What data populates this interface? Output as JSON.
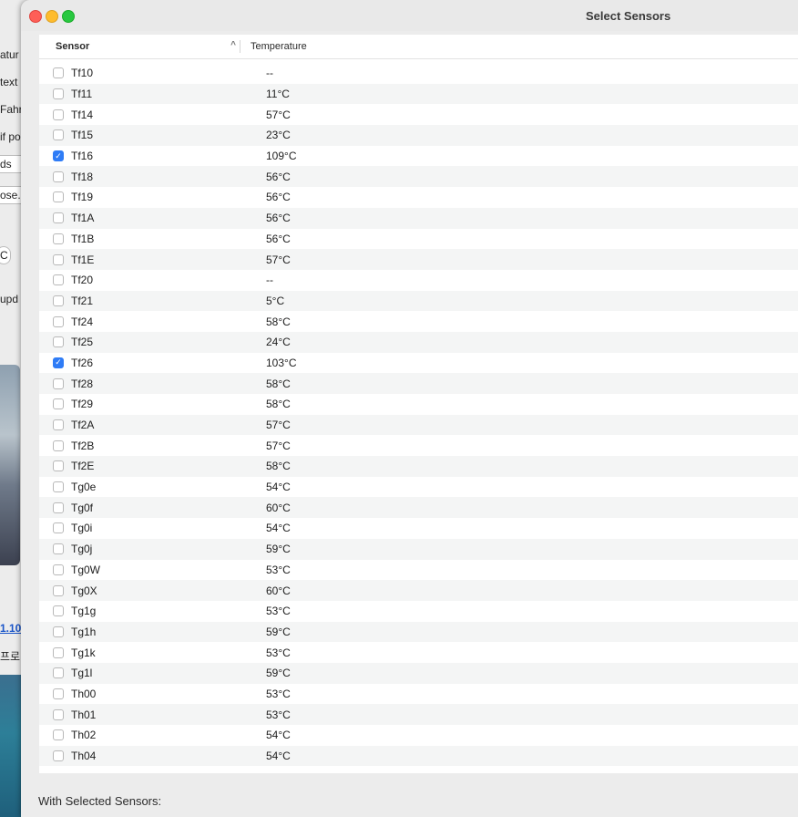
{
  "background_app": {
    "fragments": [
      "atur",
      "text",
      "Fahre",
      "if po",
      "ds",
      "ose.",
      "C",
      "upd",
      "1.10",
      "프로"
    ]
  },
  "window": {
    "title": "Select Sensors",
    "columns": {
      "sensor": "Sensor",
      "temperature": "Temperature"
    },
    "sort_indicator": "^",
    "rows": [
      {
        "sensor": "Tf10",
        "temp": "--",
        "checked": false
      },
      {
        "sensor": "Tf11",
        "temp": "11°C",
        "checked": false
      },
      {
        "sensor": "Tf14",
        "temp": "57°C",
        "checked": false
      },
      {
        "sensor": "Tf15",
        "temp": "23°C",
        "checked": false
      },
      {
        "sensor": "Tf16",
        "temp": "109°C",
        "checked": true
      },
      {
        "sensor": "Tf18",
        "temp": "56°C",
        "checked": false
      },
      {
        "sensor": "Tf19",
        "temp": "56°C",
        "checked": false
      },
      {
        "sensor": "Tf1A",
        "temp": "56°C",
        "checked": false
      },
      {
        "sensor": "Tf1B",
        "temp": "56°C",
        "checked": false
      },
      {
        "sensor": "Tf1E",
        "temp": "57°C",
        "checked": false
      },
      {
        "sensor": "Tf20",
        "temp": "--",
        "checked": false
      },
      {
        "sensor": "Tf21",
        "temp": "5°C",
        "checked": false
      },
      {
        "sensor": "Tf24",
        "temp": "58°C",
        "checked": false
      },
      {
        "sensor": "Tf25",
        "temp": "24°C",
        "checked": false
      },
      {
        "sensor": "Tf26",
        "temp": "103°C",
        "checked": true
      },
      {
        "sensor": "Tf28",
        "temp": "58°C",
        "checked": false
      },
      {
        "sensor": "Tf29",
        "temp": "58°C",
        "checked": false
      },
      {
        "sensor": "Tf2A",
        "temp": "57°C",
        "checked": false
      },
      {
        "sensor": "Tf2B",
        "temp": "57°C",
        "checked": false
      },
      {
        "sensor": "Tf2E",
        "temp": "58°C",
        "checked": false
      },
      {
        "sensor": "Tg0e",
        "temp": "54°C",
        "checked": false
      },
      {
        "sensor": "Tg0f",
        "temp": "60°C",
        "checked": false
      },
      {
        "sensor": "Tg0i",
        "temp": "54°C",
        "checked": false
      },
      {
        "sensor": "Tg0j",
        "temp": "59°C",
        "checked": false
      },
      {
        "sensor": "Tg0W",
        "temp": "53°C",
        "checked": false
      },
      {
        "sensor": "Tg0X",
        "temp": "60°C",
        "checked": false
      },
      {
        "sensor": "Tg1g",
        "temp": "53°C",
        "checked": false
      },
      {
        "sensor": "Tg1h",
        "temp": "59°C",
        "checked": false
      },
      {
        "sensor": "Tg1k",
        "temp": "53°C",
        "checked": false
      },
      {
        "sensor": "Tg1l",
        "temp": "59°C",
        "checked": false
      },
      {
        "sensor": "Th00",
        "temp": "53°C",
        "checked": false
      },
      {
        "sensor": "Th01",
        "temp": "53°C",
        "checked": false
      },
      {
        "sensor": "Th02",
        "temp": "54°C",
        "checked": false
      },
      {
        "sensor": "Th04",
        "temp": "54°C",
        "checked": false
      }
    ],
    "footer_label": "With Selected Sensors:"
  },
  "colors": {
    "accent": "#2f7cf6",
    "close": "#fe5f57",
    "minimize": "#febc2e",
    "maximize": "#28c840"
  }
}
